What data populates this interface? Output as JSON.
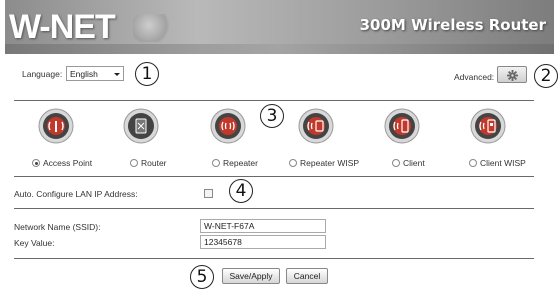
{
  "header": {
    "logo": "W-NET",
    "product": "300M Wireless Router"
  },
  "language": {
    "label": "Language:",
    "selected": "English"
  },
  "advanced": {
    "label": "Advanced:",
    "icon": "gear-icon"
  },
  "callouts": [
    "1",
    "2",
    "3",
    "4",
    "5"
  ],
  "modes": [
    {
      "label": "Access Point",
      "icon": "access-point-icon",
      "selected": true
    },
    {
      "label": "Router",
      "icon": "router-icon",
      "selected": false
    },
    {
      "label": "Repeater",
      "icon": "repeater-icon",
      "selected": false
    },
    {
      "label": "Repeater WISP",
      "icon": "repeater-wisp-icon",
      "selected": false
    },
    {
      "label": "Client",
      "icon": "client-icon",
      "selected": false
    },
    {
      "label": "Client WISP",
      "icon": "client-wisp-icon",
      "selected": false
    }
  ],
  "lan": {
    "label": "Auto. Configure LAN IP Address:",
    "checked": false
  },
  "wireless": {
    "ssid_label": "Network Name (SSID):",
    "ssid_value": "W-NET-F67A",
    "key_label": "Key Value:",
    "key_value": "12345678"
  },
  "actions": {
    "save_label": "Save/Apply",
    "cancel_label": "Cancel"
  },
  "colors": {
    "header_gray": "#9a9a9a",
    "icon_dark": "#3a3a3a",
    "icon_accent": "#c0392b"
  }
}
